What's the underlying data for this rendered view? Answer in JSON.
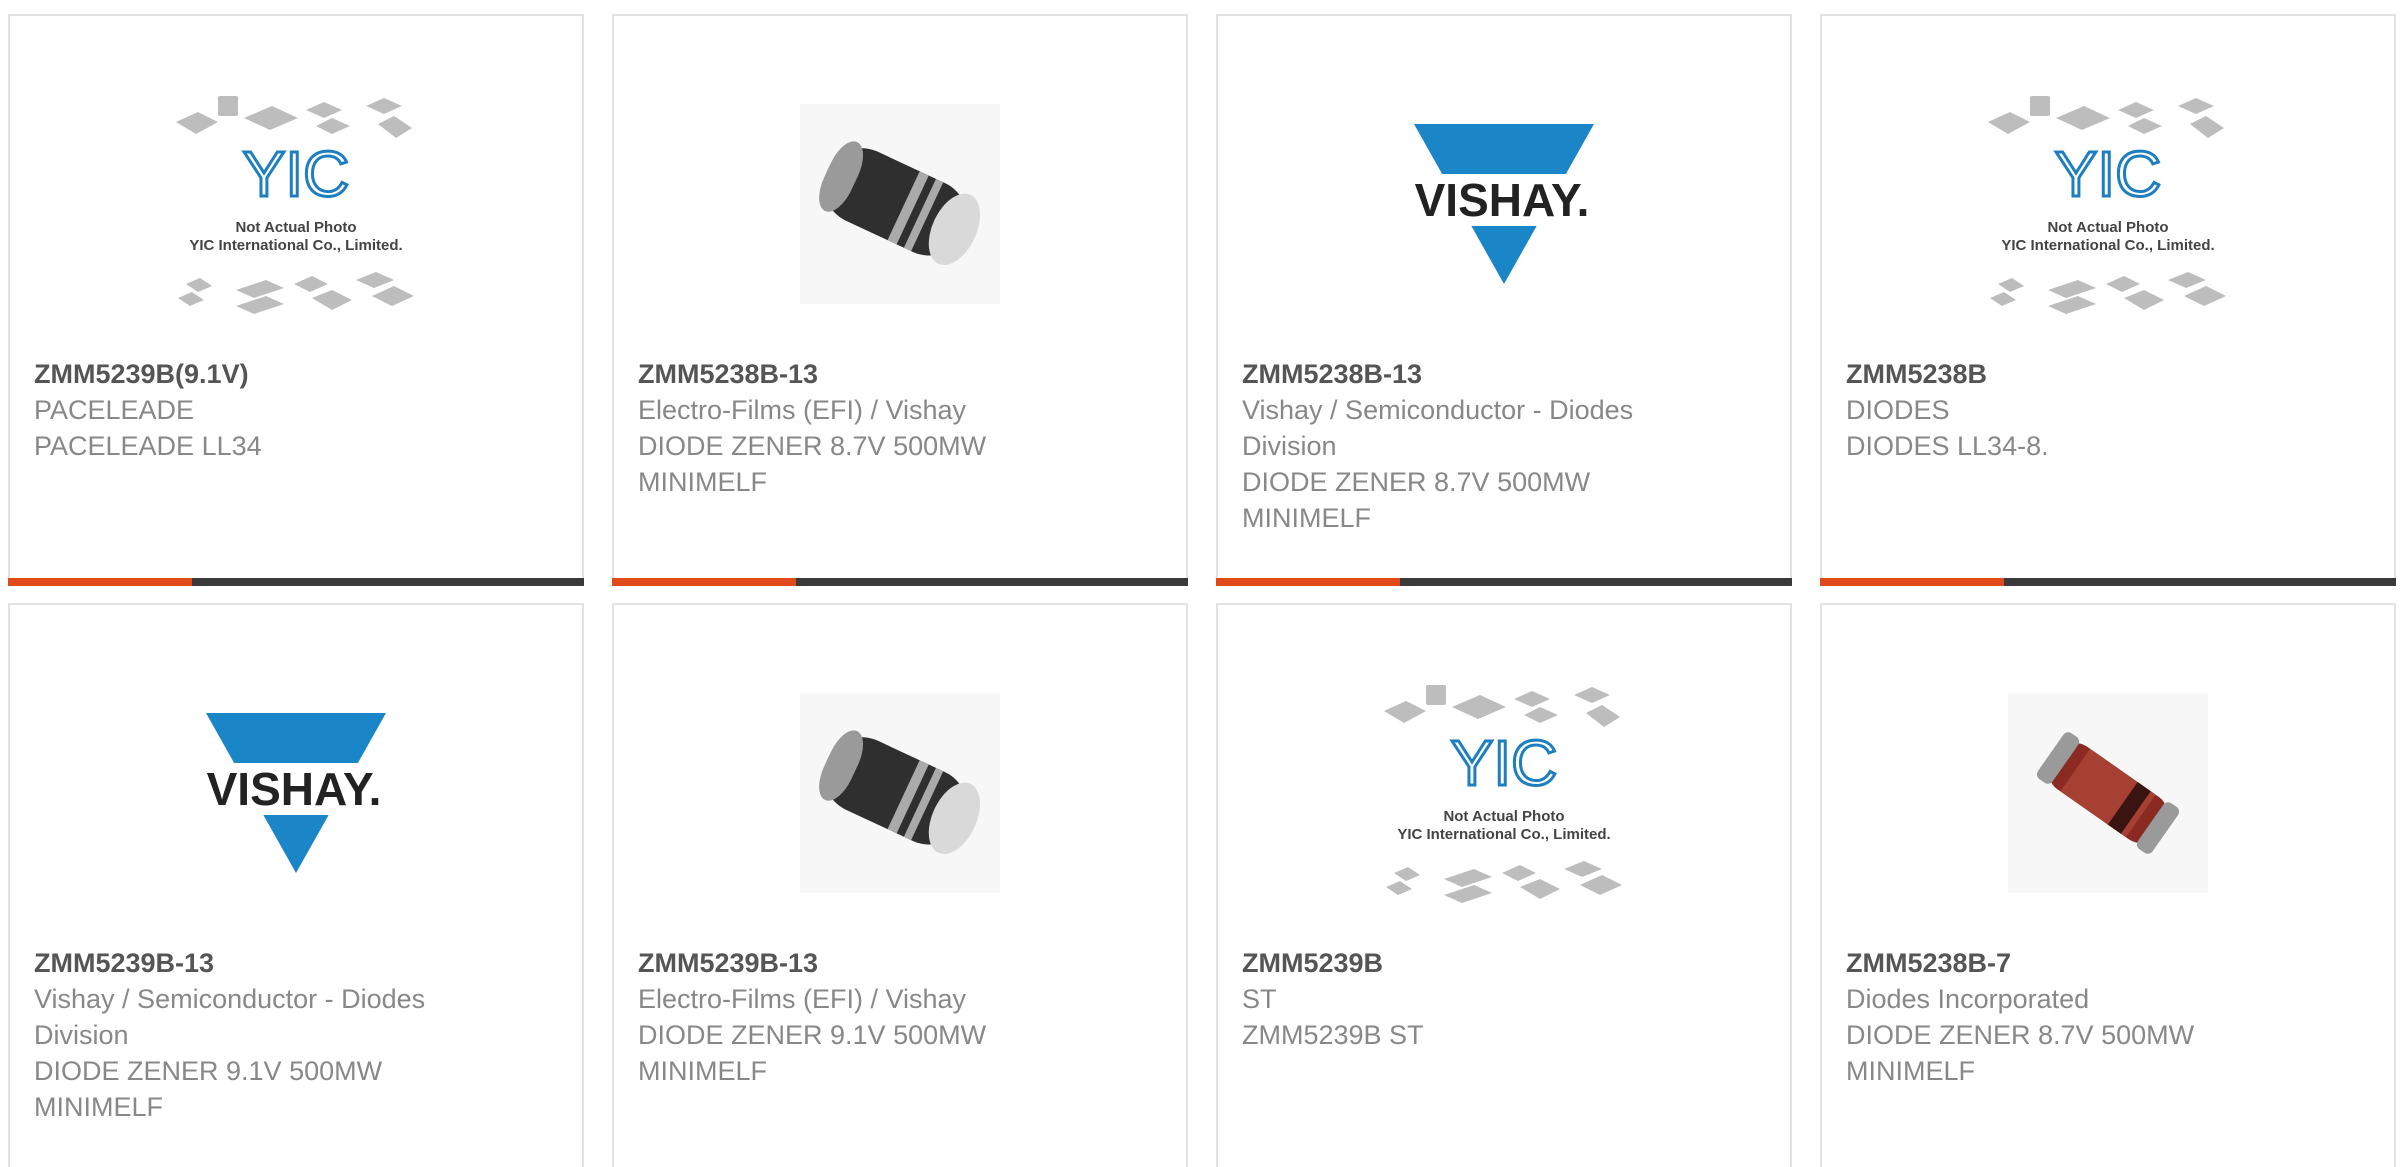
{
  "colors": {
    "accent": "#e04a1a",
    "bar_dark": "#3a3a3a",
    "part_number": "#555555",
    "muted_text": "#888888",
    "vishay_blue": "#1a86c8"
  },
  "placeholder_logo": {
    "brand": "YIC",
    "line1": "Not Actual Photo",
    "line2": "YIC International Co., Limited."
  },
  "vishay_logo": {
    "text": "VISHAY."
  },
  "products": [
    {
      "part_number": "ZMM5239B(9.1V)",
      "manufacturer": "PACELEADE",
      "description": "PACELEADE LL34",
      "image": "placeholder-photo-icon"
    },
    {
      "part_number": "ZMM5238B-13",
      "manufacturer": "Electro-Films (EFI) / Vishay",
      "description": "DIODE ZENER 8.7V 500MW MINIMELF",
      "image": "diode-minimelf-gray-icon"
    },
    {
      "part_number": "ZMM5238B-13",
      "manufacturer": "Vishay / Semiconductor - Diodes Division",
      "description": "DIODE ZENER 8.7V 500MW MINIMELF",
      "image": "vishay-logo-icon"
    },
    {
      "part_number": "ZMM5238B",
      "manufacturer": "DIODES",
      "description": "DIODES LL34-8.",
      "image": "placeholder-photo-icon"
    },
    {
      "part_number": "ZMM5239B-13",
      "manufacturer": "Vishay / Semiconductor - Diodes Division",
      "description": "DIODE ZENER 9.1V 500MW MINIMELF",
      "image": "vishay-logo-icon"
    },
    {
      "part_number": "ZMM5239B-13",
      "manufacturer": "Electro-Films (EFI) / Vishay",
      "description": "DIODE ZENER 9.1V 500MW MINIMELF",
      "image": "diode-minimelf-gray-icon"
    },
    {
      "part_number": "ZMM5239B",
      "manufacturer": "ST",
      "description": "ZMM5239B ST",
      "image": "placeholder-photo-icon"
    },
    {
      "part_number": "ZMM5238B-7",
      "manufacturer": "Diodes Incorporated",
      "description": "DIODE ZENER 8.7V 500MW MINIMELF",
      "image": "diode-minimelf-red-icon"
    }
  ]
}
